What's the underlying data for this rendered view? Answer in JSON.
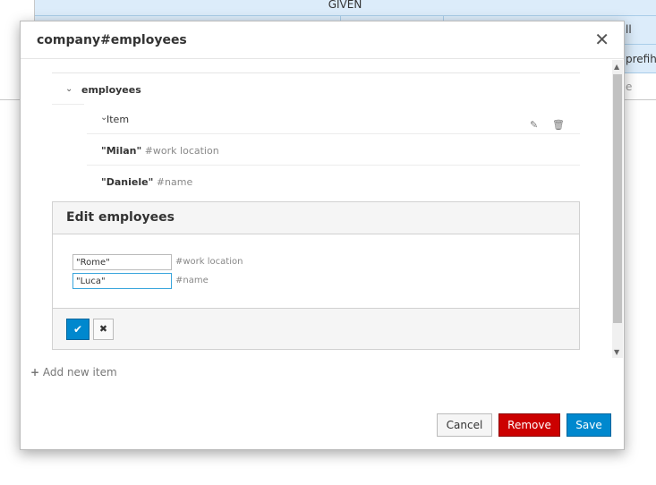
{
  "background": {
    "header_text": "GIVEN",
    "row2_partial": "ll",
    "row3_partial": "prefiho",
    "row4_partial": "e"
  },
  "modal": {
    "title": "company#employees",
    "close_glyph": "✕"
  },
  "tree": {
    "root_label": "employees",
    "item_label": "Item",
    "rows": [
      {
        "value": "\"Milan\"",
        "hint": "#work location"
      },
      {
        "value": "\"Daniele\"",
        "hint": "#name"
      }
    ]
  },
  "edit": {
    "title": "Edit employees",
    "fields": [
      {
        "value": "\"Rome\"",
        "hint": "#work location"
      },
      {
        "value": "\"Luca\"",
        "hint": "#name"
      }
    ],
    "ok_glyph": "✔",
    "cancel_glyph": "✖"
  },
  "add_item": {
    "icon": "+",
    "label": "Add new item"
  },
  "footer": {
    "cancel_label": "Cancel",
    "remove_label": "Remove",
    "save_label": "Save"
  },
  "colors": {
    "primary": "#0088ce",
    "danger": "#cc0000",
    "table_bg": "#dcecfa"
  },
  "icons": {
    "edit": "pencil-icon",
    "delete": "trash-icon"
  }
}
